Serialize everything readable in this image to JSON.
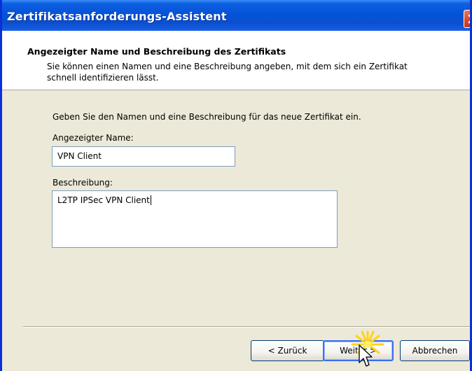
{
  "window": {
    "title": "Zertifikatsanforderungs-Assistent"
  },
  "header": {
    "title": "Angezeigter Name und Beschreibung des Zertifikats",
    "description": "Sie können einen Namen und eine Beschreibung angeben, mit dem sich ein Zertifikat schnell identifizieren lässt."
  },
  "form": {
    "intro": "Geben Sie den Namen und eine Beschreibung für das neue Zertifikat ein.",
    "name_label": "Angezeigter Name:",
    "name_value": "VPN Client",
    "description_label": "Beschreibung:",
    "description_value": "L2TP IPSec VPN Client"
  },
  "buttons": {
    "back": "< Zurück",
    "next": "Weiter >",
    "cancel": "Abbrechen"
  },
  "icons": {
    "close": "close-icon",
    "cursor": "mouse-pointer-icon",
    "click": "click-highlight-icon"
  },
  "colors": {
    "titlebar": "#0553d8",
    "close": "#d2462a",
    "dialog_bg": "#ece9d8",
    "header_bg": "#ffffff"
  }
}
